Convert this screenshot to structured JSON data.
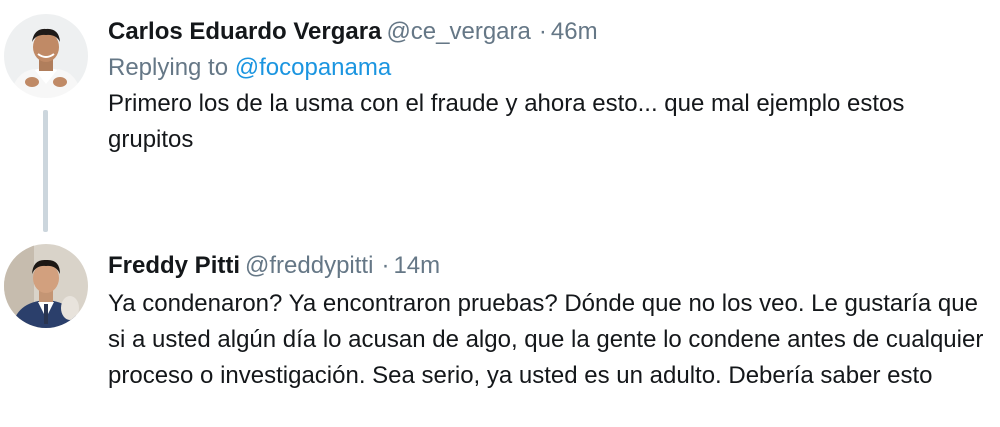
{
  "thread": {
    "tweets": [
      {
        "name": "Carlos Eduardo Vergara",
        "handle": "@ce_vergara",
        "separator": "·",
        "time": "46m",
        "replying_prefix": "Replying to",
        "replying_to": "@focopanama",
        "text": "Primero los de la usma con el fraude y ahora esto... que mal ejemplo estos grupitos",
        "avatar_icon": "user-avatar-photo"
      },
      {
        "name": "Freddy Pitti",
        "handle": "@freddypitti",
        "separator": "·",
        "time": "14m",
        "text": "Ya condenaron? Ya encontraron pruebas? Dónde que no los veo. Le gustaría que si a usted algún día lo acusan de algo, que la gente lo condene antes de cualquier proceso o investigación. Sea serio, ya usted es un adulto. Debería saber esto",
        "avatar_icon": "user-avatar-photo"
      }
    ]
  },
  "colors": {
    "name": "#14171a",
    "secondary": "#657786",
    "link": "#1b95e0",
    "thread_line": "#ccd6dd"
  }
}
